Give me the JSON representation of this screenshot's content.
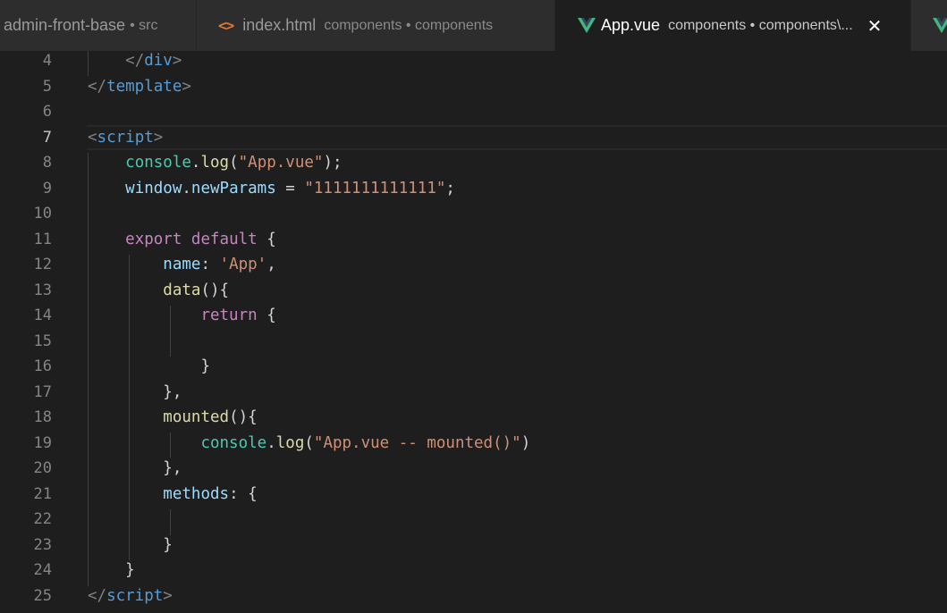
{
  "tabs": [
    {
      "title": "admin-front-base",
      "description": "• src",
      "active": false
    },
    {
      "icon": "html-code-icon",
      "icon_text": "<>",
      "title": "index.html",
      "description": "components • components",
      "active": false
    },
    {
      "icon": "vue-logo-icon",
      "title": "App.vue",
      "description": "components • components\\...",
      "active": true,
      "close": "✕"
    },
    {
      "icon": "vue-logo-icon",
      "title": "",
      "description": "",
      "active": false
    }
  ],
  "colors": {
    "vue_green": "#41b883",
    "vue_dark": "#35495e",
    "tag": "#569cd6",
    "identifier": "#9cdcfe",
    "object": "#4ec9b0",
    "function": "#dcdcaa",
    "string": "#ce9178",
    "keyword": "#c586c0"
  },
  "editor": {
    "current_line": 7,
    "line_numbers": [
      "4",
      "5",
      "6",
      "7",
      "8",
      "9",
      "10",
      "11",
      "12",
      "13",
      "14",
      "15",
      "16",
      "17",
      "18",
      "19",
      "20",
      "21",
      "22",
      "23",
      "24",
      "25"
    ],
    "lines": [
      {
        "indent": "    ",
        "tokens": [
          {
            "t": "</",
            "c": "tag-bracket"
          },
          {
            "t": "div",
            "c": "tag"
          },
          {
            "t": ">",
            "c": "tag-bracket"
          }
        ]
      },
      {
        "indent": "",
        "tokens": [
          {
            "t": "</",
            "c": "tag-bracket"
          },
          {
            "t": "template",
            "c": "tag"
          },
          {
            "t": ">",
            "c": "tag-bracket"
          }
        ]
      },
      {
        "indent": "",
        "tokens": []
      },
      {
        "indent": "",
        "tokens": [
          {
            "t": "<",
            "c": "tag-bracket"
          },
          {
            "t": "script",
            "c": "tag"
          },
          {
            "t": ">",
            "c": "tag-bracket"
          }
        ]
      },
      {
        "indent": "    ",
        "tokens": [
          {
            "t": "console",
            "c": "obj"
          },
          {
            "t": ".",
            "c": "punct"
          },
          {
            "t": "log",
            "c": "fn"
          },
          {
            "t": "(",
            "c": "punct"
          },
          {
            "t": "\"App.vue\"",
            "c": "str"
          },
          {
            "t": ");",
            "c": "punct"
          }
        ]
      },
      {
        "indent": "    ",
        "tokens": [
          {
            "t": "window",
            "c": "id"
          },
          {
            "t": ".",
            "c": "punct"
          },
          {
            "t": "newParams",
            "c": "id"
          },
          {
            "t": " = ",
            "c": "punct"
          },
          {
            "t": "\"1111111111111\"",
            "c": "str"
          },
          {
            "t": ";",
            "c": "punct"
          }
        ]
      },
      {
        "indent": "",
        "tokens": []
      },
      {
        "indent": "    ",
        "tokens": [
          {
            "t": "export",
            "c": "kw"
          },
          {
            "t": " ",
            "c": "punct"
          },
          {
            "t": "default",
            "c": "kw"
          },
          {
            "t": " {",
            "c": "punct"
          }
        ]
      },
      {
        "indent": "        ",
        "tokens": [
          {
            "t": "name",
            "c": "id"
          },
          {
            "t": ": ",
            "c": "punct"
          },
          {
            "t": "'App'",
            "c": "str"
          },
          {
            "t": ",",
            "c": "punct"
          }
        ]
      },
      {
        "indent": "        ",
        "tokens": [
          {
            "t": "data",
            "c": "fn"
          },
          {
            "t": "(){",
            "c": "punct"
          }
        ]
      },
      {
        "indent": "            ",
        "tokens": [
          {
            "t": "return",
            "c": "kw"
          },
          {
            "t": " {",
            "c": "punct"
          }
        ]
      },
      {
        "indent": "",
        "tokens": []
      },
      {
        "indent": "            ",
        "tokens": [
          {
            "t": "}",
            "c": "punct"
          }
        ]
      },
      {
        "indent": "        ",
        "tokens": [
          {
            "t": "},",
            "c": "punct"
          }
        ]
      },
      {
        "indent": "        ",
        "tokens": [
          {
            "t": "mounted",
            "c": "fn"
          },
          {
            "t": "(){",
            "c": "punct"
          }
        ]
      },
      {
        "indent": "            ",
        "tokens": [
          {
            "t": "console",
            "c": "obj"
          },
          {
            "t": ".",
            "c": "punct"
          },
          {
            "t": "log",
            "c": "fn"
          },
          {
            "t": "(",
            "c": "punct"
          },
          {
            "t": "\"App.vue -- mounted()\"",
            "c": "str"
          },
          {
            "t": ")",
            "c": "punct"
          }
        ]
      },
      {
        "indent": "        ",
        "tokens": [
          {
            "t": "},",
            "c": "punct"
          }
        ]
      },
      {
        "indent": "        ",
        "tokens": [
          {
            "t": "methods",
            "c": "id"
          },
          {
            "t": ": {",
            "c": "punct"
          }
        ]
      },
      {
        "indent": "",
        "tokens": []
      },
      {
        "indent": "        ",
        "tokens": [
          {
            "t": "}",
            "c": "punct"
          }
        ]
      },
      {
        "indent": "    ",
        "tokens": [
          {
            "t": "}",
            "c": "punct"
          }
        ]
      },
      {
        "indent": "",
        "tokens": [
          {
            "t": "</",
            "c": "tag-bracket"
          },
          {
            "t": "script",
            "c": "tag"
          },
          {
            "t": ">",
            "c": "tag-bracket"
          }
        ]
      }
    ]
  }
}
